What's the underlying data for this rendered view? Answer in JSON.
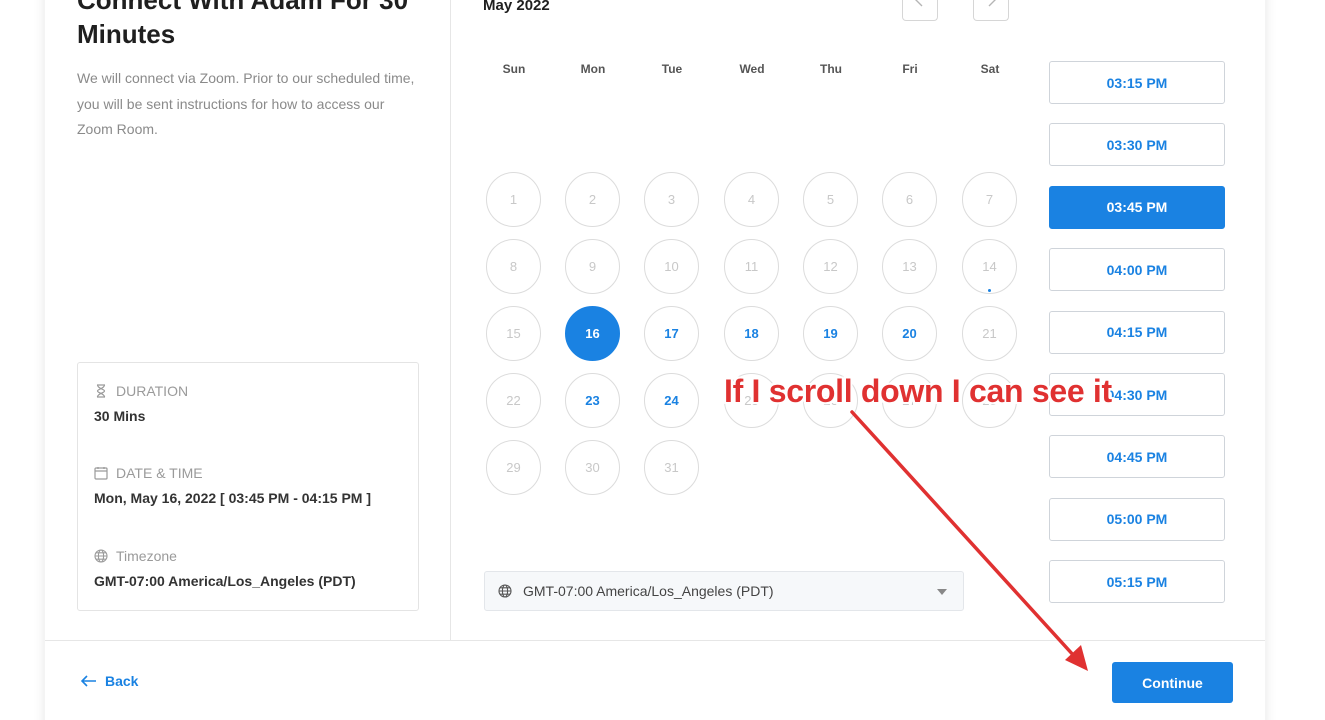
{
  "event": {
    "title": "Connect With Adam For 30 Minutes",
    "description": "We will connect via Zoom. Prior to our scheduled time, you will be sent instructions for how to access our Zoom Room."
  },
  "details": {
    "duration_label": "DURATION",
    "duration_value": "30 Mins",
    "datetime_label": "DATE & TIME",
    "datetime_value": "Mon, May 16, 2022 [ 03:45 PM - 04:15 PM ]",
    "timezone_label": "Timezone",
    "timezone_value": "GMT-07:00 America/Los_Angeles (PDT)"
  },
  "calendar": {
    "month": "May 2022",
    "weekdays": [
      "Sun",
      "Mon",
      "Tue",
      "Wed",
      "Thu",
      "Fri",
      "Sat"
    ],
    "days": [
      "1",
      "2",
      "3",
      "4",
      "5",
      "6",
      "7",
      "8",
      "9",
      "10",
      "11",
      "12",
      "13",
      "14",
      "15",
      "16",
      "17",
      "18",
      "19",
      "20",
      "21",
      "22",
      "23",
      "24",
      "25",
      "26",
      "27",
      "28",
      "29",
      "30",
      "31"
    ],
    "available_days": [
      "16",
      "17",
      "18",
      "19",
      "20",
      "23",
      "24"
    ],
    "selected_day": "16",
    "today_marker_day": "14"
  },
  "timezone_select": {
    "value": "GMT-07:00 America/Los_Angeles (PDT)"
  },
  "time_slots": [
    "03:15 PM",
    "03:30 PM",
    "03:45 PM",
    "04:00 PM",
    "04:15 PM",
    "04:30 PM",
    "04:45 PM",
    "05:00 PM",
    "05:15 PM"
  ],
  "selected_slot": "03:45 PM",
  "footer": {
    "back_label": "Back",
    "continue_label": "Continue"
  },
  "annotation": {
    "text": "If I scroll down I can see it"
  },
  "colors": {
    "accent": "#1a82e2",
    "annotation": "#e03131"
  }
}
